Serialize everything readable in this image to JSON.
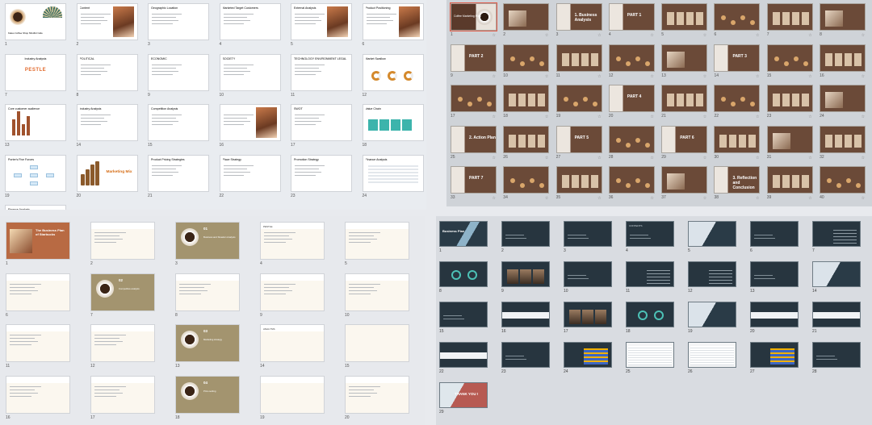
{
  "panels": [
    {
      "name": "coffee-shop-template",
      "slides": [
        {
          "n": "1",
          "kind": "cover",
          "title": "Kaleo Coffee Shop Mindful Cafe",
          "icon": ""
        },
        {
          "n": "2",
          "kind": "photo",
          "title": "Content",
          "icon": ""
        },
        {
          "n": "3",
          "kind": "text",
          "title": "Geographic Location",
          "icon": ""
        },
        {
          "n": "4",
          "kind": "text",
          "title": "Marketed Target Customers",
          "icon": ""
        },
        {
          "n": "5",
          "kind": "photo",
          "title": "External Analysis",
          "icon": ""
        },
        {
          "n": "6",
          "kind": "photo",
          "title": "Product Positioning",
          "icon": ""
        },
        {
          "n": "7",
          "kind": "pestle",
          "title": "Industry Analysis",
          "word": "PESTLE",
          "icon": ""
        },
        {
          "n": "8",
          "kind": "text",
          "title": "POLITICAL",
          "icon": ""
        },
        {
          "n": "9",
          "kind": "text",
          "title": "ECONOMIC",
          "icon": ""
        },
        {
          "n": "10",
          "kind": "text",
          "title": "SOCIETY",
          "icon": ""
        },
        {
          "n": "11",
          "kind": "text",
          "title": "TECHNOLOGY  ENVIRONMENT  LEGAL",
          "icon": ""
        },
        {
          "n": "12",
          "kind": "donuts",
          "title": "Market Swallow",
          "icon": ""
        },
        {
          "n": "13",
          "kind": "bars",
          "title": "Core customer audience",
          "icon": ""
        },
        {
          "n": "14",
          "kind": "text",
          "title": "Industry Analysis",
          "icon": ""
        },
        {
          "n": "15",
          "kind": "text",
          "title": "Competition Analysis",
          "icon": ""
        },
        {
          "n": "16",
          "kind": "photo",
          "title": "",
          "icon": ""
        },
        {
          "n": "17",
          "kind": "text",
          "title": "SWOT",
          "icon": ""
        },
        {
          "n": "18",
          "kind": "teal",
          "title": "Value Chain",
          "icon": ""
        },
        {
          "n": "19",
          "kind": "porter",
          "title": "Porter's Five Forces",
          "icon": ""
        },
        {
          "n": "20",
          "kind": "mix",
          "title": "",
          "word": "Marketing Mix",
          "icon": ""
        },
        {
          "n": "21",
          "kind": "text",
          "title": "Product Pricing Strategies",
          "icon": ""
        },
        {
          "n": "22",
          "kind": "text",
          "title": "Place Strategy",
          "icon": ""
        },
        {
          "n": "23",
          "kind": "text",
          "title": "Promotion Strategy",
          "icon": ""
        },
        {
          "n": "24",
          "kind": "table",
          "title": "Finance Analysis",
          "icon": ""
        },
        {
          "n": "25",
          "kind": "chart",
          "title": "Finance Analysis",
          "icon": ""
        }
      ]
    },
    {
      "name": "coffee-marketing-plan-template",
      "slides": [
        {
          "n": "1",
          "kind": "cover",
          "title": "Coffee Marketing Plan",
          "icon": "☆"
        },
        {
          "n": "2",
          "kind": "photo",
          "title": "",
          "icon": "☆"
        },
        {
          "n": "3",
          "kind": "part",
          "title": "1. Business Analysis",
          "icon": "☆"
        },
        {
          "n": "4",
          "kind": "part",
          "title": "PART 1",
          "icon": "☆"
        },
        {
          "n": "5",
          "kind": "cards",
          "title": "",
          "icon": "☆"
        },
        {
          "n": "6",
          "kind": "dots",
          "title": "",
          "icon": "☆"
        },
        {
          "n": "7",
          "kind": "cards",
          "title": "",
          "icon": "☆"
        },
        {
          "n": "8",
          "kind": "photo",
          "title": "",
          "icon": "☆"
        },
        {
          "n": "9",
          "kind": "part",
          "title": "PART 2",
          "icon": "☆"
        },
        {
          "n": "10",
          "kind": "dots",
          "title": "",
          "icon": "☆"
        },
        {
          "n": "11",
          "kind": "cards",
          "title": "",
          "icon": "☆"
        },
        {
          "n": "12",
          "kind": "dots",
          "title": "",
          "icon": "☆"
        },
        {
          "n": "13",
          "kind": "photo",
          "title": "",
          "icon": "☆"
        },
        {
          "n": "14",
          "kind": "part",
          "title": "PART 3",
          "icon": "☆"
        },
        {
          "n": "15",
          "kind": "dots",
          "title": "",
          "icon": "☆"
        },
        {
          "n": "16",
          "kind": "cards",
          "title": "",
          "icon": "☆"
        },
        {
          "n": "17",
          "kind": "dots",
          "title": "",
          "icon": "☆"
        },
        {
          "n": "18",
          "kind": "cards",
          "title": "",
          "icon": "☆"
        },
        {
          "n": "19",
          "kind": "dots",
          "title": "",
          "icon": "☆"
        },
        {
          "n": "20",
          "kind": "part",
          "title": "PART 4",
          "icon": "☆"
        },
        {
          "n": "21",
          "kind": "cards",
          "title": "",
          "icon": "☆"
        },
        {
          "n": "22",
          "kind": "dots",
          "title": "",
          "icon": "☆"
        },
        {
          "n": "23",
          "kind": "cards",
          "title": "",
          "icon": "☆"
        },
        {
          "n": "24",
          "kind": "photo",
          "title": "",
          "icon": "☆"
        },
        {
          "n": "25",
          "kind": "part",
          "title": "2. Action Plan",
          "icon": "☆"
        },
        {
          "n": "26",
          "kind": "cards",
          "title": "",
          "icon": "☆"
        },
        {
          "n": "27",
          "kind": "part",
          "title": "PART 5",
          "icon": "☆"
        },
        {
          "n": "28",
          "kind": "dots",
          "title": "",
          "icon": "☆"
        },
        {
          "n": "29",
          "kind": "part",
          "title": "PART 6",
          "icon": "☆"
        },
        {
          "n": "30",
          "kind": "cards",
          "title": "",
          "icon": "☆"
        },
        {
          "n": "31",
          "kind": "photo",
          "title": "",
          "icon": "☆"
        },
        {
          "n": "32",
          "kind": "cards",
          "title": "",
          "icon": "☆"
        },
        {
          "n": "33",
          "kind": "part",
          "title": "PART 7",
          "icon": "☆"
        },
        {
          "n": "34",
          "kind": "dots",
          "title": "",
          "icon": "☆"
        },
        {
          "n": "35",
          "kind": "cards",
          "title": "",
          "icon": "☆"
        },
        {
          "n": "36",
          "kind": "dots",
          "title": "",
          "icon": "☆"
        },
        {
          "n": "37",
          "kind": "photo",
          "title": "",
          "icon": "☆"
        },
        {
          "n": "38",
          "kind": "part",
          "title": "3. Reflection and Conclusion",
          "icon": "☆"
        },
        {
          "n": "39",
          "kind": "cards",
          "title": "",
          "icon": "☆"
        },
        {
          "n": "40",
          "kind": "dots",
          "title": "",
          "icon": "☆"
        }
      ]
    },
    {
      "name": "business-plan-starbucks-template",
      "slides": [
        {
          "n": "1",
          "kind": "rust",
          "title": "The Business Plan of Starbucks",
          "icon": ""
        },
        {
          "n": "2",
          "kind": "beige",
          "title": "",
          "icon": ""
        },
        {
          "n": "3",
          "kind": "khaki",
          "title": "01",
          "sub": "Business and Situation Analysis",
          "icon": ""
        },
        {
          "n": "4",
          "kind": "beige",
          "title": "PESTLE",
          "icon": ""
        },
        {
          "n": "5",
          "kind": "beige",
          "title": "",
          "icon": ""
        },
        {
          "n": "6",
          "kind": "beige",
          "title": "",
          "icon": ""
        },
        {
          "n": "7",
          "kind": "khaki",
          "title": "02",
          "sub": "Competitive analysis",
          "icon": ""
        },
        {
          "n": "8",
          "kind": "beige",
          "title": "",
          "icon": ""
        },
        {
          "n": "9",
          "kind": "beige",
          "title": "",
          "icon": ""
        },
        {
          "n": "10",
          "kind": "beige",
          "title": "",
          "icon": ""
        },
        {
          "n": "11",
          "kind": "beige",
          "title": "",
          "icon": ""
        },
        {
          "n": "12",
          "kind": "beige",
          "title": "",
          "icon": ""
        },
        {
          "n": "13",
          "kind": "khaki",
          "title": "03",
          "sub": "Marketing strategy",
          "icon": ""
        },
        {
          "n": "14",
          "kind": "photo3",
          "title": "ANALYSIS",
          "icon": ""
        },
        {
          "n": "15",
          "kind": "bars3",
          "title": "",
          "icon": ""
        },
        {
          "n": "16",
          "kind": "beige",
          "title": "",
          "icon": ""
        },
        {
          "n": "17",
          "kind": "beige",
          "title": "",
          "icon": ""
        },
        {
          "n": "18",
          "kind": "khaki",
          "title": "04",
          "sub": "Price setting",
          "icon": ""
        },
        {
          "n": "19",
          "kind": "photo3",
          "title": "",
          "icon": ""
        },
        {
          "n": "20",
          "kind": "beige",
          "title": "",
          "icon": ""
        }
      ]
    },
    {
      "name": "business-plan-dark-template",
      "slides": [
        {
          "n": "1",
          "kind": "dkcover",
          "title": "Business Plan",
          "icon": ""
        },
        {
          "n": "2",
          "kind": "dk",
          "title": "",
          "icon": ""
        },
        {
          "n": "3",
          "kind": "dk",
          "title": "",
          "icon": ""
        },
        {
          "n": "4",
          "kind": "dk",
          "title": "CONTENTS",
          "icon": ""
        },
        {
          "n": "5",
          "kind": "dklight",
          "title": "",
          "icon": ""
        },
        {
          "n": "6",
          "kind": "dk",
          "title": "",
          "icon": ""
        },
        {
          "n": "7",
          "kind": "dktbl",
          "title": "",
          "icon": ""
        },
        {
          "n": "8",
          "kind": "dkcirc",
          "title": "",
          "icon": ""
        },
        {
          "n": "9",
          "kind": "dkphoto",
          "title": "",
          "icon": ""
        },
        {
          "n": "10",
          "kind": "dk",
          "title": "",
          "icon": ""
        },
        {
          "n": "11",
          "kind": "dktbl",
          "title": "",
          "icon": ""
        },
        {
          "n": "12",
          "kind": "dktbl",
          "title": "",
          "icon": ""
        },
        {
          "n": "13",
          "kind": "dk",
          "title": "",
          "icon": ""
        },
        {
          "n": "14",
          "kind": "dklight",
          "title": "",
          "icon": ""
        },
        {
          "n": "15",
          "kind": "dk",
          "title": "",
          "icon": ""
        },
        {
          "n": "16",
          "kind": "dkband",
          "title": "",
          "icon": ""
        },
        {
          "n": "17",
          "kind": "dkphoto",
          "title": "",
          "icon": ""
        },
        {
          "n": "18",
          "kind": "dkcirc",
          "title": "",
          "icon": ""
        },
        {
          "n": "19",
          "kind": "dklight",
          "title": "",
          "icon": ""
        },
        {
          "n": "20",
          "kind": "dkband",
          "title": "",
          "icon": ""
        },
        {
          "n": "21",
          "kind": "dkband",
          "title": "",
          "icon": ""
        },
        {
          "n": "22",
          "kind": "dkband",
          "title": "",
          "icon": ""
        },
        {
          "n": "23",
          "kind": "dk",
          "title": "",
          "icon": ""
        },
        {
          "n": "24",
          "kind": "dkblue",
          "title": "",
          "icon": ""
        },
        {
          "n": "25",
          "kind": "dksheet",
          "title": "",
          "icon": ""
        },
        {
          "n": "26",
          "kind": "dksheet",
          "title": "",
          "icon": ""
        },
        {
          "n": "27",
          "kind": "dkblue",
          "title": "",
          "icon": ""
        },
        {
          "n": "28",
          "kind": "dk",
          "title": "",
          "icon": ""
        },
        {
          "n": "29",
          "kind": "dkthanks",
          "title": "THANK YOU !",
          "icon": ""
        }
      ]
    }
  ],
  "selected": {
    "panel": 1,
    "slide": 0
  },
  "colors": {
    "accent_selected": "#e05a47",
    "brown": "#6b4a38",
    "khaki": "#a3946f",
    "dark": "#27353f"
  }
}
